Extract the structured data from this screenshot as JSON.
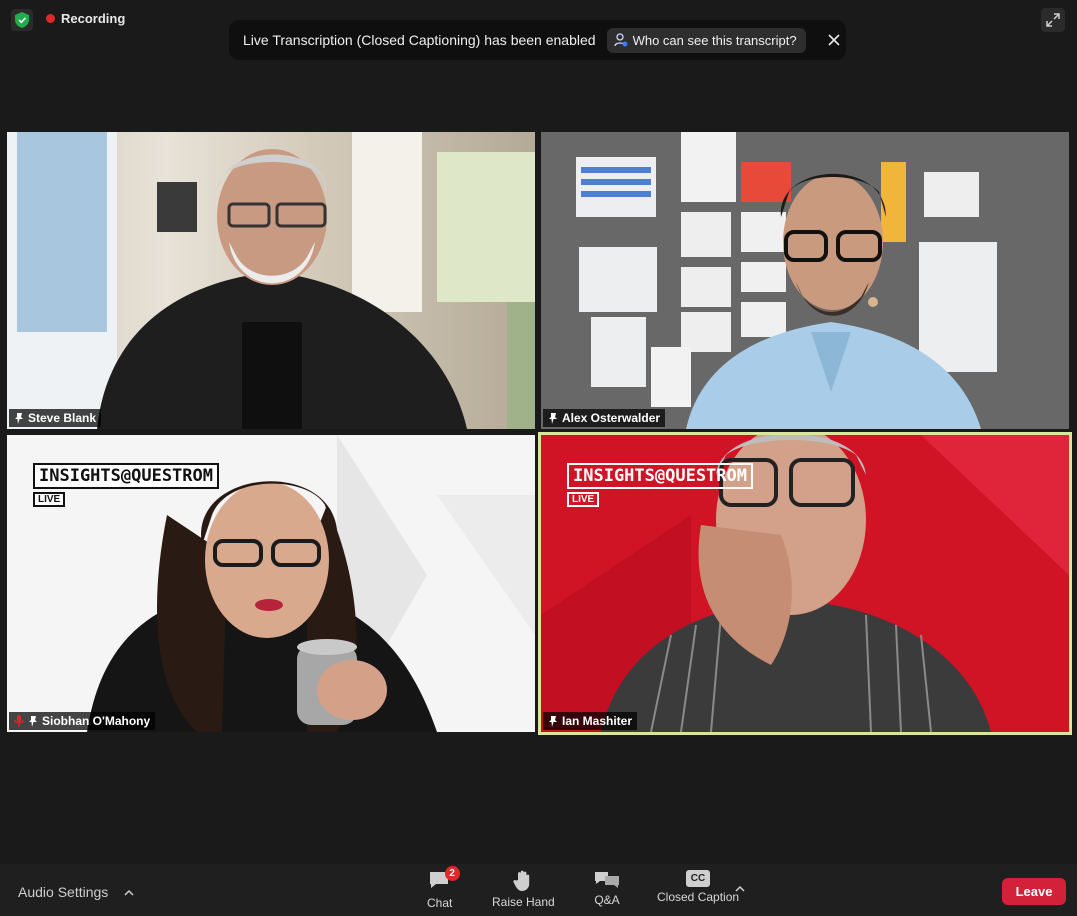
{
  "top": {
    "recording_label": "Recording",
    "notice_text": "Live Transcription (Closed Captioning) has been enabled",
    "who_button_label": "Who can see this transcript?"
  },
  "participants": [
    {
      "name": "Steve Blank",
      "muted": false,
      "active": false
    },
    {
      "name": "Alex Osterwalder",
      "muted": false,
      "active": false
    },
    {
      "name": "Siobhan O'Mahony",
      "muted": true,
      "active": false
    },
    {
      "name": "Ian Mashiter",
      "muted": false,
      "active": true
    }
  ],
  "branding": {
    "logo_text": "INSIGHTS@QUESTROM",
    "logo_sub": "LIVE"
  },
  "toolbar": {
    "audio_settings_label": "Audio Settings",
    "chat_label": "Chat",
    "chat_badge": "2",
    "raise_hand_label": "Raise Hand",
    "qa_label": "Q&A",
    "cc_icon_text": "CC",
    "closed_caption_label": "Closed Caption",
    "leave_label": "Leave"
  },
  "colors": {
    "background": "#1a1a1a",
    "recording_dot": "#e02828",
    "shield": "#1fae4b",
    "leave": "#d4213a",
    "active_speaker_border": "#d9e79a",
    "questrom_red": "#d01426"
  },
  "icons": [
    "shield-icon",
    "recording-dot-icon",
    "expand-icon",
    "person-info-icon",
    "close-icon",
    "pin-icon",
    "mic-muted-icon",
    "chat-icon",
    "raise-hand-icon",
    "qa-icon",
    "cc-icon",
    "chevron-up-icon"
  ]
}
